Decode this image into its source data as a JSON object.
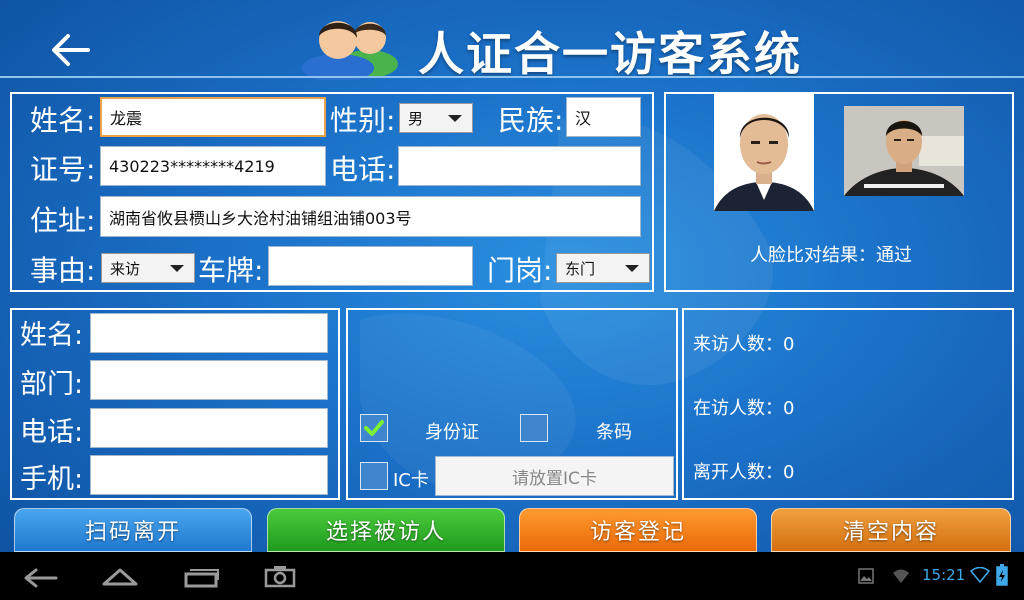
{
  "header": {
    "title": "人证合一访客系统"
  },
  "visitor": {
    "name_label": "姓名:",
    "name_value": "龙震",
    "gender_label": "性别:",
    "gender_value": "男",
    "ethnic_label": "民族:",
    "ethnic_value": "汉",
    "id_label": "证号:",
    "id_value": "430223********4219",
    "phone_label": "电话:",
    "phone_value": "",
    "address_label": "住址:",
    "address_value": "湖南省攸县槚山乡大沧村油铺组油铺003号",
    "reason_label": "事由:",
    "reason_value": "来访",
    "plate_label": "车牌:",
    "plate_value": "",
    "gate_label": "门岗:",
    "gate_value": "东门"
  },
  "face": {
    "result_text": "人脸比对结果：通过"
  },
  "host": {
    "name_label": "姓名:",
    "dept_label": "部门:",
    "phone_label": "电话:",
    "mobile_label": "手机:"
  },
  "options": {
    "idcard_label": "身份证",
    "idcard_checked": true,
    "barcode_label": "条码",
    "barcode_checked": false,
    "iccard_label": "IC卡",
    "iccard_checked": false,
    "ic_placeholder": "请放置IC卡"
  },
  "stats": {
    "visit_count": "来访人数：0",
    "present_count": "在访人数：0",
    "left_count": "离开人数：0"
  },
  "buttons": {
    "scan_leave": "扫码离开",
    "select_host": "选择被访人",
    "register": "访客登记",
    "clear": "清空内容"
  },
  "colors": {
    "scan": "#2f8fe0",
    "select": "#2aa82a",
    "register": "#f27a10",
    "clear": "#e07a10"
  },
  "statusbar": {
    "time": "15:21"
  }
}
